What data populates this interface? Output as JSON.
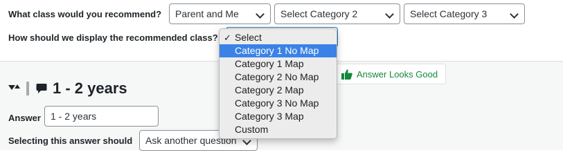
{
  "form": {
    "class_question": "What class would you recommend?",
    "class_select_1": "Parent and Me",
    "class_select_2": "Select Category 2",
    "class_select_3": "Select Category 3",
    "display_question": "How should we display the recommended class?"
  },
  "dropdown": {
    "options": [
      {
        "label": "Select",
        "checked": true,
        "highlighted": false
      },
      {
        "label": "Category 1 No Map",
        "checked": false,
        "highlighted": true
      },
      {
        "label": "Category 1 Map",
        "checked": false,
        "highlighted": false
      },
      {
        "label": "Category 2 No Map",
        "checked": false,
        "highlighted": false
      },
      {
        "label": "Category 2 Map",
        "checked": false,
        "highlighted": false
      },
      {
        "label": "Category 3 No Map",
        "checked": false,
        "highlighted": false
      },
      {
        "label": "Category 3 Map",
        "checked": false,
        "highlighted": false
      },
      {
        "label": "Custom",
        "checked": false,
        "highlighted": false
      }
    ],
    "check_glyph": "✓"
  },
  "answer_block": {
    "title": "1 - 2 years",
    "answer_label": "Answer",
    "answer_value": "1 - 2 years",
    "selecting_label": "Selecting this answer should",
    "action_value": "Ask another question",
    "answer_good_label": "Answer Looks Good"
  },
  "icons": {
    "sort": "sort-toggle-icon",
    "comment": "comment-icon",
    "thumbs_up": "thumbs-up-icon",
    "chevron": "chevron-down-icon"
  },
  "colors": {
    "highlight": "#3b82e6",
    "success": "#14883a",
    "panel_bg": "#f6f7f7"
  }
}
